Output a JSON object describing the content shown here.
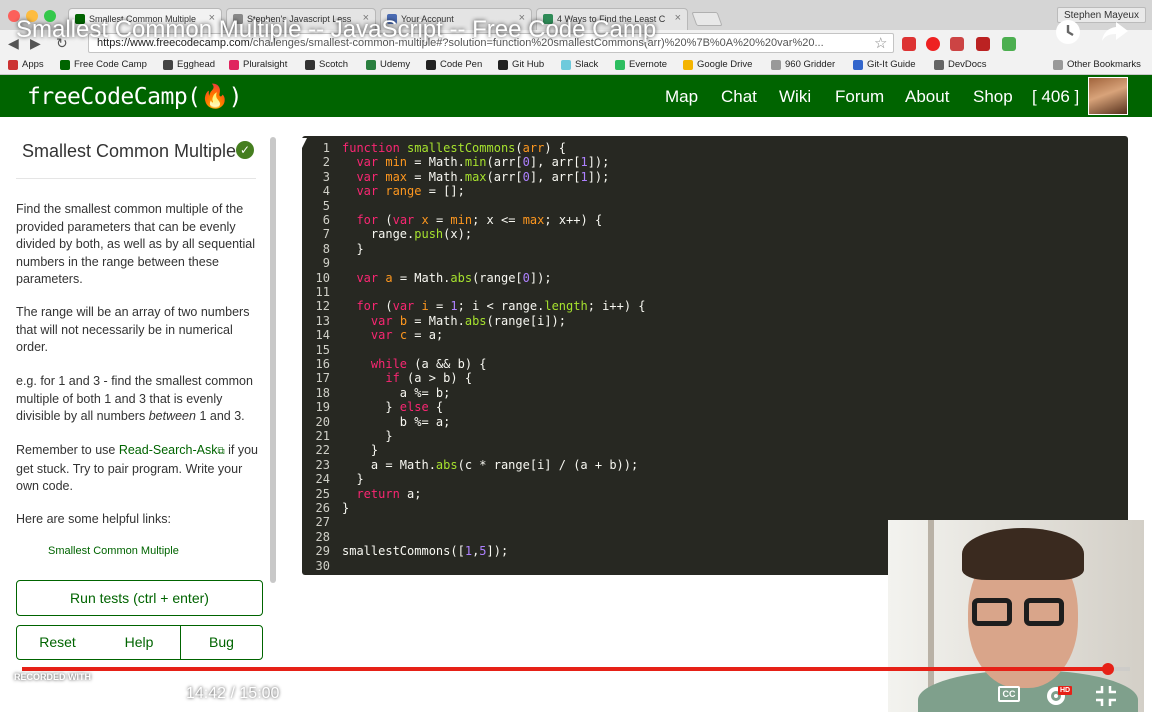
{
  "video": {
    "title": "Smallest Common Multiple -- JavaScript -- Free Code Camp",
    "current_time": "14:42",
    "duration": "15:00",
    "progress": 0.98,
    "recorded_with": "RECORDED WITH",
    "watermark": "SCREENCAST-O-MATIC",
    "cc_label": "CC",
    "hd_label": "HD"
  },
  "browser": {
    "tabs": [
      {
        "label": "Smallest Common Multiple",
        "favicon_color": "#006400",
        "active": true
      },
      {
        "label": "Stephen's Javascript Less",
        "favicon_color": "#888888",
        "active": false
      },
      {
        "label": "Your Account",
        "favicon_color": "#4a6bb3",
        "active": false
      },
      {
        "label": "4 Ways to Find the Least C",
        "favicon_color": "#2e8b57",
        "active": false
      }
    ],
    "profile": "Stephen Mayeux",
    "url_host": "https://www.freecodecamp.com",
    "url_rest": "/challenges/smallest-common-multiple#?solution=function%20smallestCommons(arr)%20%7B%0A%20%20var%20..."
  },
  "bookmarks": [
    {
      "label": "Apps",
      "color": "#c33"
    },
    {
      "label": "Free Code Camp",
      "color": "#006400"
    },
    {
      "label": "Egghead",
      "color": "#444"
    },
    {
      "label": "Pluralsight",
      "color": "#e0245e"
    },
    {
      "label": "Scotch",
      "color": "#333"
    },
    {
      "label": "Udemy",
      "color": "#2a7f3f"
    },
    {
      "label": "Code Pen",
      "color": "#222"
    },
    {
      "label": "Git Hub",
      "color": "#222"
    },
    {
      "label": "Slack",
      "color": "#6ecadc"
    },
    {
      "label": "Evernote",
      "color": "#2dbe60"
    },
    {
      "label": "Google Drive",
      "color": "#f4b400"
    },
    {
      "label": "960 Gridder",
      "color": "#999"
    },
    {
      "label": "Git-It Guide",
      "color": "#3366cc"
    },
    {
      "label": "DevDocs",
      "color": "#666"
    },
    {
      "label": "Other Bookmarks",
      "color": "#999"
    }
  ],
  "fcc": {
    "logo": "freeCodeCamp(🔥)",
    "nav": [
      "Map",
      "Chat",
      "Wiki",
      "Forum",
      "About",
      "Shop",
      "[ 406 ]"
    ]
  },
  "challenge": {
    "title": "Smallest Common Multiple",
    "para1": "Find the smallest common multiple of the provided parameters that can be evenly divided by both, as well as by all sequential numbers in the range between these parameters.",
    "para2": "The range will be an array of two numbers that will not necessarily be in numerical order.",
    "para3_a": "e.g. for 1 and 3 - find the smallest common multiple of both 1 and 3 that is evenly divisible by all numbers ",
    "para3_em": "between",
    "para3_b": " 1 and 3.",
    "para4_a": "Remember to use ",
    "para4_link": "Read-Search-Ask",
    "para4_b": " if you get stuck. Try to pair program. Write your own code.",
    "para5": "Here are some helpful links:",
    "helpful_link": "Smallest Common Multiple",
    "buttons": {
      "run": "Run tests (ctrl + enter)",
      "reset": "Reset",
      "help": "Help",
      "bug": "Bug"
    }
  },
  "code_lines": [
    [
      [
        "k",
        "function "
      ],
      [
        "f",
        "smallestCommons"
      ],
      [
        "p",
        "("
      ],
      [
        "a",
        "arr"
      ],
      [
        "p",
        ") {"
      ]
    ],
    [
      [
        "p",
        "  "
      ],
      [
        "k",
        "var "
      ],
      [
        "v",
        "min"
      ],
      [
        "p",
        " = Math."
      ],
      [
        "f",
        "min"
      ],
      [
        "p",
        "(arr["
      ],
      [
        "n",
        "0"
      ],
      [
        "p",
        "], arr["
      ],
      [
        "n",
        "1"
      ],
      [
        "p",
        "]);"
      ]
    ],
    [
      [
        "p",
        "  "
      ],
      [
        "k",
        "var "
      ],
      [
        "v",
        "max"
      ],
      [
        "p",
        " = Math."
      ],
      [
        "f",
        "max"
      ],
      [
        "p",
        "(arr["
      ],
      [
        "n",
        "0"
      ],
      [
        "p",
        "], arr["
      ],
      [
        "n",
        "1"
      ],
      [
        "p",
        "]);"
      ]
    ],
    [
      [
        "p",
        "  "
      ],
      [
        "k",
        "var "
      ],
      [
        "v",
        "range"
      ],
      [
        "p",
        " = [];"
      ]
    ],
    [
      [
        "p",
        ""
      ]
    ],
    [
      [
        "p",
        "  "
      ],
      [
        "k",
        "for "
      ],
      [
        "p",
        "("
      ],
      [
        "k",
        "var "
      ],
      [
        "v",
        "x"
      ],
      [
        "p",
        " = "
      ],
      [
        "v",
        "min"
      ],
      [
        "p",
        "; x <= "
      ],
      [
        "v",
        "max"
      ],
      [
        "p",
        "; x++) {"
      ]
    ],
    [
      [
        "p",
        "    range."
      ],
      [
        "f",
        "push"
      ],
      [
        "p",
        "(x);"
      ]
    ],
    [
      [
        "p",
        "  }"
      ]
    ],
    [
      [
        "p",
        ""
      ]
    ],
    [
      [
        "p",
        "  "
      ],
      [
        "k",
        "var "
      ],
      [
        "v",
        "a"
      ],
      [
        "p",
        " = Math."
      ],
      [
        "f",
        "abs"
      ],
      [
        "p",
        "(range["
      ],
      [
        "n",
        "0"
      ],
      [
        "p",
        "]);"
      ]
    ],
    [
      [
        "p",
        ""
      ]
    ],
    [
      [
        "p",
        "  "
      ],
      [
        "k",
        "for "
      ],
      [
        "p",
        "("
      ],
      [
        "k",
        "var "
      ],
      [
        "v",
        "i"
      ],
      [
        "p",
        " = "
      ],
      [
        "n",
        "1"
      ],
      [
        "p",
        "; i < range."
      ],
      [
        "f",
        "length"
      ],
      [
        "p",
        "; i++) {"
      ]
    ],
    [
      [
        "p",
        "    "
      ],
      [
        "k",
        "var "
      ],
      [
        "v",
        "b"
      ],
      [
        "p",
        " = Math."
      ],
      [
        "f",
        "abs"
      ],
      [
        "p",
        "(range[i]);"
      ]
    ],
    [
      [
        "p",
        "    "
      ],
      [
        "k",
        "var "
      ],
      [
        "v",
        "c"
      ],
      [
        "p",
        " = a;"
      ]
    ],
    [
      [
        "p",
        ""
      ]
    ],
    [
      [
        "p",
        "    "
      ],
      [
        "k",
        "while "
      ],
      [
        "p",
        "(a && b) {"
      ]
    ],
    [
      [
        "p",
        "      "
      ],
      [
        "k",
        "if "
      ],
      [
        "p",
        "(a > b) {"
      ]
    ],
    [
      [
        "p",
        "        a %= b;"
      ]
    ],
    [
      [
        "p",
        "      } "
      ],
      [
        "k",
        "else "
      ],
      [
        "p",
        "{"
      ]
    ],
    [
      [
        "p",
        "        b %= a;"
      ]
    ],
    [
      [
        "p",
        "      }"
      ]
    ],
    [
      [
        "p",
        "    }"
      ]
    ],
    [
      [
        "p",
        "    a = Math."
      ],
      [
        "f",
        "abs"
      ],
      [
        "p",
        "(c * range[i] / (a + b));"
      ]
    ],
    [
      [
        "p",
        "  }"
      ]
    ],
    [
      [
        "p",
        "  "
      ],
      [
        "k",
        "return "
      ],
      [
        "p",
        "a;"
      ]
    ],
    [
      [
        "p",
        "}"
      ]
    ],
    [
      [
        "p",
        ""
      ]
    ],
    [
      [
        "p",
        ""
      ]
    ],
    [
      [
        "p",
        "smallestCommons(["
      ],
      [
        "n",
        "1"
      ],
      [
        "p",
        ","
      ],
      [
        "n",
        "5"
      ],
      [
        "p",
        "]);"
      ]
    ],
    [
      [
        "p",
        ""
      ]
    ]
  ],
  "syntax_colors": {
    "k": "#f92672",
    "f": "#a6e22e",
    "a": "#fd971f",
    "v": "#fd971f",
    "n": "#ae81ff",
    "p": "#f8f8f2"
  }
}
